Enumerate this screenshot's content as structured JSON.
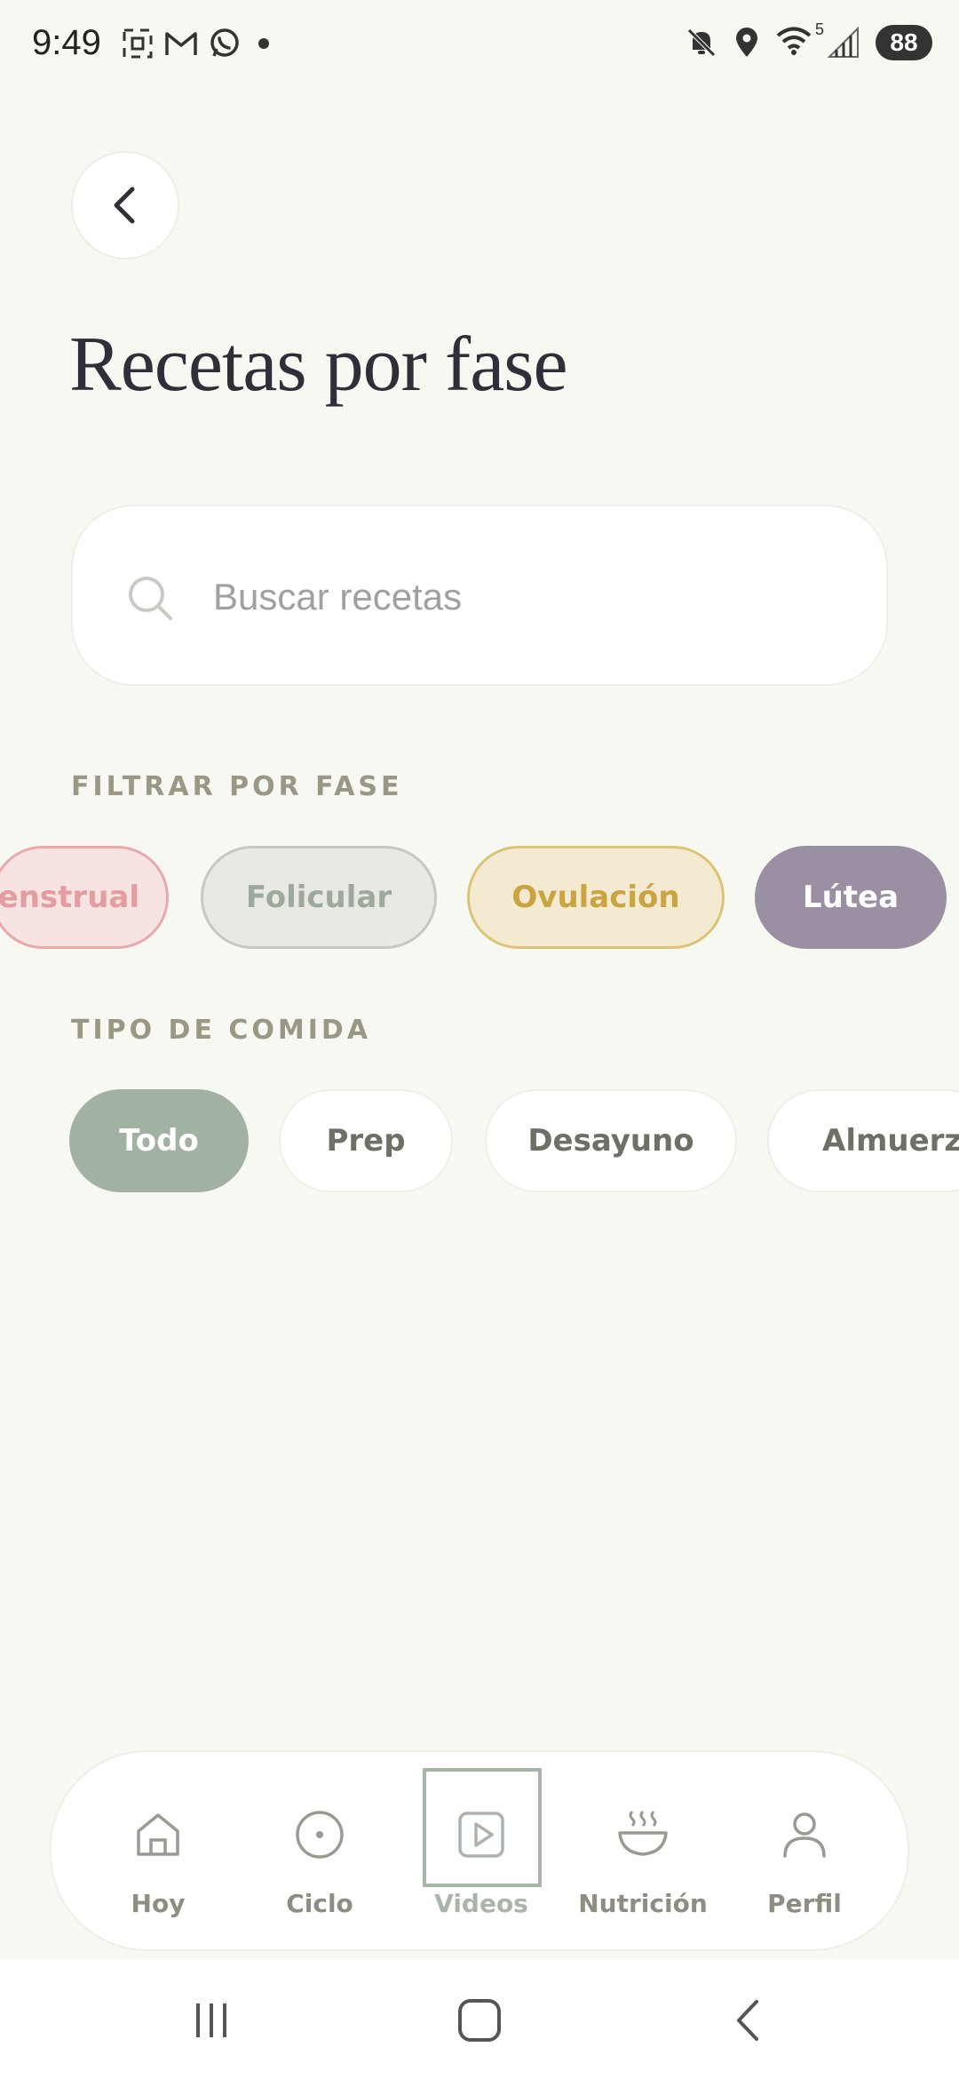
{
  "status_bar": {
    "time": "9:49",
    "battery": "88",
    "signal_label": "5"
  },
  "page": {
    "title": "Recetas por fase"
  },
  "search": {
    "placeholder": "Buscar recetas",
    "value": ""
  },
  "phase_filter": {
    "label": "FILTRAR POR FASE",
    "chips": [
      {
        "label": "Menstrual",
        "visible_text": "enstrual",
        "bg": "#f7e3e2",
        "border": "#e9a9aa",
        "color": "#e39c9f"
      },
      {
        "label": "Folicular",
        "bg": "#e8e9e2",
        "border": "#c5c9bf",
        "color": "#9ea99d"
      },
      {
        "label": "Ovulación",
        "bg": "#f3ead1",
        "border": "#dcc476",
        "color": "#c9a441"
      },
      {
        "label": "Lútea",
        "bg": "#9b8fa3",
        "border": "#9b8fa3",
        "color": "#ffffff"
      }
    ]
  },
  "meal_type": {
    "label": "TIPO DE COMIDA",
    "chips": [
      {
        "label": "Todo",
        "selected": true,
        "bg": "#a2b2a2",
        "color": "#ffffff"
      },
      {
        "label": "Prep",
        "selected": false,
        "bg": "#ffffff",
        "color": "#6f6f66"
      },
      {
        "label": "Desayuno",
        "selected": false,
        "bg": "#ffffff",
        "color": "#6f6f66"
      },
      {
        "label": "Almuerzo",
        "selected": false,
        "bg": "#ffffff",
        "color": "#6f6f66"
      }
    ]
  },
  "bottom_nav": {
    "items": [
      {
        "label": "Hoy",
        "icon": "home-icon"
      },
      {
        "label": "Ciclo",
        "icon": "cycle-icon"
      },
      {
        "label": "Videos",
        "icon": "play-icon",
        "active": true
      },
      {
        "label": "Nutrición",
        "icon": "bowl-icon"
      },
      {
        "label": "Perfil",
        "icon": "person-icon"
      }
    ]
  },
  "colors": {
    "background": "#f8f8f3",
    "title": "#2f2f3a",
    "section_label": "#9a9785",
    "nav_label": "#8e8d80",
    "accent_sage": "#a2b2a2"
  }
}
